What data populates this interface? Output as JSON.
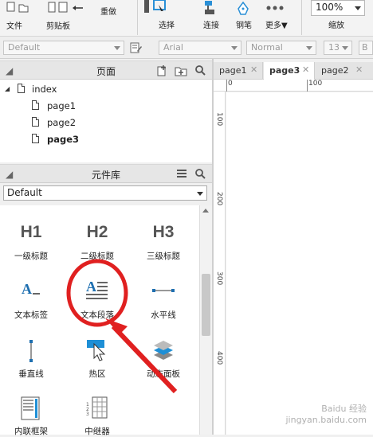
{
  "toolbar": {
    "file": "文件",
    "clipboard": "剪贴板",
    "redo": "重做",
    "select": "选择",
    "connect": "连接",
    "pen": "钢笔",
    "more": "更多▼",
    "zoom_value": "100%",
    "zoom_label": "缩放"
  },
  "format": {
    "style": "Default",
    "font": "Arial",
    "weight": "Normal",
    "size": "13",
    "bold": "B"
  },
  "pages_panel": {
    "title": "页面",
    "root": "index",
    "pages": [
      "page1",
      "page2",
      "page3"
    ]
  },
  "library_panel": {
    "title": "元件库",
    "selected": "Default",
    "items": [
      {
        "big": "H1",
        "label": "一级标题"
      },
      {
        "big": "H2",
        "label": "二级标题"
      },
      {
        "big": "H3",
        "label": "三级标题"
      },
      {
        "label": "文本标签"
      },
      {
        "label": "文本段落"
      },
      {
        "label": "水平线"
      },
      {
        "label": "垂直线"
      },
      {
        "label": "热区"
      },
      {
        "label": "动态面板"
      },
      {
        "label": "内联框架"
      },
      {
        "label": "中继器"
      }
    ]
  },
  "tabs": [
    {
      "label": "page1"
    },
    {
      "label": "page3"
    },
    {
      "label": "page2"
    }
  ],
  "ruler": {
    "top_ticks": [
      "0",
      "100"
    ],
    "left_ticks": [
      "100",
      "200",
      "300",
      "400"
    ]
  },
  "watermark": "Baidu 经验 jingyan.baidu.com"
}
